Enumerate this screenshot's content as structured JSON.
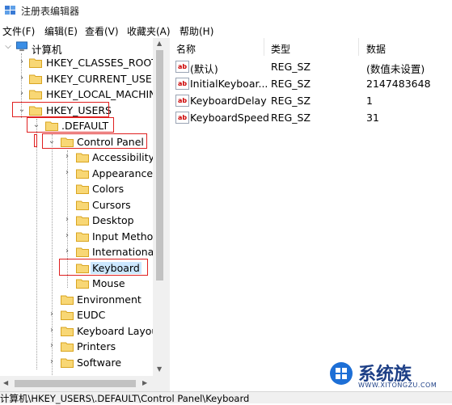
{
  "window": {
    "title": "注册表编辑器"
  },
  "menu": [
    {
      "label": "文件(F)"
    },
    {
      "label": "编辑(E)"
    },
    {
      "label": "查看(V)"
    },
    {
      "label": "收藏夹(A)"
    },
    {
      "label": "帮助(H)"
    }
  ],
  "tree": {
    "computer": "计算机",
    "hkcr": "HKEY_CLASSES_ROOT",
    "hkcu": "HKEY_CURRENT_USER",
    "hklm": "HKEY_LOCAL_MACHINE",
    "hku": "HKEY_USERS",
    "default": ".DEFAULT",
    "control_panel": "Control Panel",
    "accessibility": "Accessibility",
    "appearance": "Appearance",
    "colors": "Colors",
    "cursors": "Cursors",
    "desktop": "Desktop",
    "input_method": "Input Method",
    "international": "International",
    "keyboard": "Keyboard",
    "mouse": "Mouse",
    "environment": "Environment",
    "eudc": "EUDC",
    "keyboard_layout": "Keyboard Layout",
    "printers": "Printers",
    "software": "Software"
  },
  "columns": {
    "name": "名称",
    "type": "类型",
    "data": "数据"
  },
  "values": [
    {
      "name": "(默认)",
      "type": "REG_SZ",
      "data": "(数值未设置)"
    },
    {
      "name": "InitialKeyboar...",
      "type": "REG_SZ",
      "data": "2147483648"
    },
    {
      "name": "KeyboardDelay",
      "type": "REG_SZ",
      "data": "1"
    },
    {
      "name": "KeyboardSpeed",
      "type": "REG_SZ",
      "data": "31"
    }
  ],
  "status": {
    "path": "计算机\\HKEY_USERS\\.DEFAULT\\Control Panel\\Keyboard"
  },
  "watermark": {
    "brand": "系统族",
    "url": "WWW.XITONGZU.COM"
  },
  "colors": {
    "folder": "#f8d775",
    "folder_edge": "#d9a521",
    "highlight": "#e02020",
    "selection": "#cce8ff"
  },
  "icons": {
    "app": "registry-editor-icon",
    "folder": "folder-icon",
    "value": "string-value-icon",
    "computer": "computer-icon"
  }
}
